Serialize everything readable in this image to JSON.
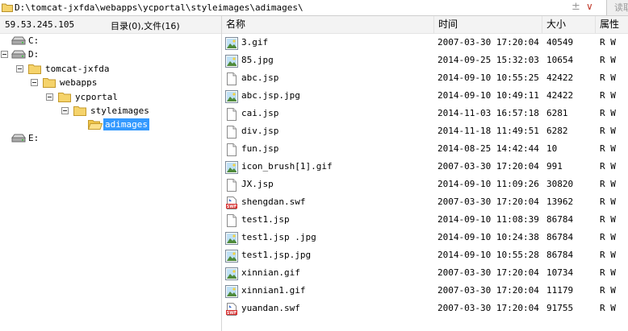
{
  "path_bar": {
    "path": "D:\\tomcat-jxfda\\webapps\\ycportal\\styleimages\\adimages\\",
    "plus_minus": "±",
    "dropdown": "∨",
    "read_button": "读取"
  },
  "left_header": {
    "ip": "59.53.245.105",
    "summary": "目录(0),文件(16)"
  },
  "tree": {
    "drive_c": "C:",
    "drive_d": "D:",
    "tomcat": "tomcat-jxfda",
    "webapps": "webapps",
    "ycportal": "ycportal",
    "styleimages": "styleimages",
    "adimages": "adimages",
    "drive_e": "E:"
  },
  "columns": {
    "name": "名称",
    "time": "时间",
    "size": "大小",
    "attr": "属性"
  },
  "files": [
    {
      "name": "3.gif",
      "time": "2007-03-30 17:20:04",
      "size": "40549",
      "attr": "R W",
      "icon": "image-icon"
    },
    {
      "name": "85.jpg",
      "time": "2014-09-25 15:32:03",
      "size": "10654",
      "attr": "R W",
      "icon": "image-icon"
    },
    {
      "name": "abc.jsp",
      "time": "2014-09-10 10:55:25",
      "size": "42422",
      "attr": "R W",
      "icon": "file-icon"
    },
    {
      "name": "abc.jsp.jpg",
      "time": "2014-09-10 10:49:11",
      "size": "42422",
      "attr": "R W",
      "icon": "image-icon"
    },
    {
      "name": "cai.jsp",
      "time": "2014-11-03 16:57:18",
      "size": "6281",
      "attr": "R W",
      "icon": "file-icon"
    },
    {
      "name": "div.jsp",
      "time": "2014-11-18 11:49:51",
      "size": "6282",
      "attr": "R W",
      "icon": "file-icon"
    },
    {
      "name": "fun.jsp",
      "time": "2014-08-25 14:42:44",
      "size": "10",
      "attr": "R W",
      "icon": "file-icon"
    },
    {
      "name": "icon_brush[1].gif",
      "time": "2007-03-30 17:20:04",
      "size": "991",
      "attr": "R W",
      "icon": "image-icon"
    },
    {
      "name": "JX.jsp",
      "time": "2014-09-10 11:09:26",
      "size": "30820",
      "attr": "R W",
      "icon": "file-icon"
    },
    {
      "name": "shengdan.swf",
      "time": "2007-03-30 17:20:04",
      "size": "13962",
      "attr": "R W",
      "icon": "swf-icon"
    },
    {
      "name": "test1.jsp",
      "time": "2014-09-10 11:08:39",
      "size": "86784",
      "attr": "R W",
      "icon": "file-icon"
    },
    {
      "name": "test1.jsp .jpg",
      "time": "2014-09-10 10:24:38",
      "size": "86784",
      "attr": "R W",
      "icon": "image-icon"
    },
    {
      "name": "test1.jsp.jpg",
      "time": "2014-09-10 10:55:28",
      "size": "86784",
      "attr": "R W",
      "icon": "image-icon"
    },
    {
      "name": "xinnian.gif",
      "time": "2007-03-30 17:20:04",
      "size": "10734",
      "attr": "R W",
      "icon": "image-icon"
    },
    {
      "name": "xinnian1.gif",
      "time": "2007-03-30 17:20:04",
      "size": "11179",
      "attr": "R W",
      "icon": "image-icon"
    },
    {
      "name": "yuandan.swf",
      "time": "2007-03-30 17:20:04",
      "size": "91755",
      "attr": "R W",
      "icon": "swf-icon"
    }
  ]
}
